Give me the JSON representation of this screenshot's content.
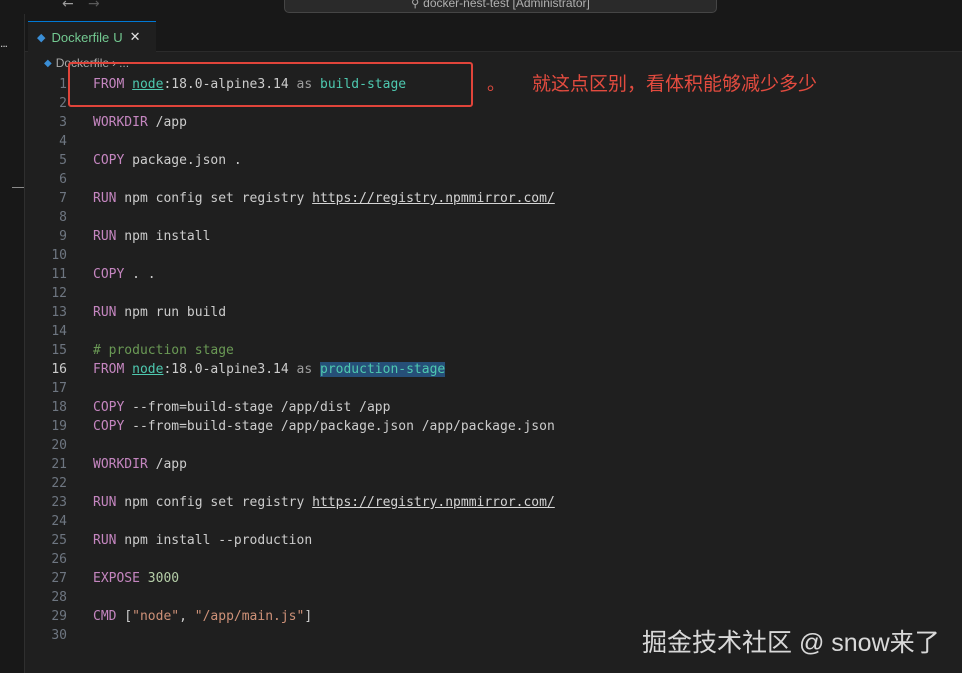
{
  "titlebar": {
    "back_icon": "arrow-left-icon",
    "forward_icon": "arrow-right-icon",
    "search_icon": "search-icon",
    "command_center_label": "docker-nest-test [Administrator]"
  },
  "activitybar": {
    "more_icon": "ellipsis-icon",
    "more_label": "..."
  },
  "tab": {
    "icon": "docker-icon",
    "label": "Dockerfile",
    "status": "U",
    "close_icon": "close-icon"
  },
  "breadcrumb": {
    "file": "Dockerfile",
    "separator": "›",
    "more": "..."
  },
  "editor": {
    "active_line": 16,
    "lines": [
      {
        "n": "1",
        "code": "FROM node:18.0-alpine3.14 as build-stage"
      },
      {
        "n": "2",
        "code": ""
      },
      {
        "n": "3",
        "code": "WORKDIR /app"
      },
      {
        "n": "4",
        "code": ""
      },
      {
        "n": "5",
        "code": "COPY package.json ."
      },
      {
        "n": "6",
        "code": ""
      },
      {
        "n": "7",
        "code": "RUN npm config set registry https://registry.npmmirror.com/"
      },
      {
        "n": "8",
        "code": ""
      },
      {
        "n": "9",
        "code": "RUN npm install"
      },
      {
        "n": "10",
        "code": ""
      },
      {
        "n": "11",
        "code": "COPY . ."
      },
      {
        "n": "12",
        "code": ""
      },
      {
        "n": "13",
        "code": "RUN npm run build"
      },
      {
        "n": "14",
        "code": ""
      },
      {
        "n": "15",
        "code": "# production stage"
      },
      {
        "n": "16",
        "code": "FROM node:18.0-alpine3.14 as production-stage"
      },
      {
        "n": "17",
        "code": ""
      },
      {
        "n": "18",
        "code": "COPY --from=build-stage /app/dist /app"
      },
      {
        "n": "19",
        "code": "COPY --from=build-stage /app/package.json /app/package.json"
      },
      {
        "n": "20",
        "code": ""
      },
      {
        "n": "21",
        "code": "WORKDIR /app"
      },
      {
        "n": "22",
        "code": ""
      },
      {
        "n": "23",
        "code": "RUN npm config set registry https://registry.npmmirror.com/"
      },
      {
        "n": "24",
        "code": ""
      },
      {
        "n": "25",
        "code": "RUN npm install --production"
      },
      {
        "n": "26",
        "code": ""
      },
      {
        "n": "27",
        "code": "EXPOSE 3000"
      },
      {
        "n": "28",
        "code": ""
      },
      {
        "n": "29",
        "code": "CMD [\"node\", \"/app/main.js\"]"
      },
      {
        "n": "30",
        "code": ""
      }
    ]
  },
  "annotation": {
    "dot": "。",
    "text": "就这点区别，看体积能够减少多少",
    "color": "#e24b3f"
  },
  "watermark": {
    "text": "掘金技术社区 @ snow来了"
  }
}
